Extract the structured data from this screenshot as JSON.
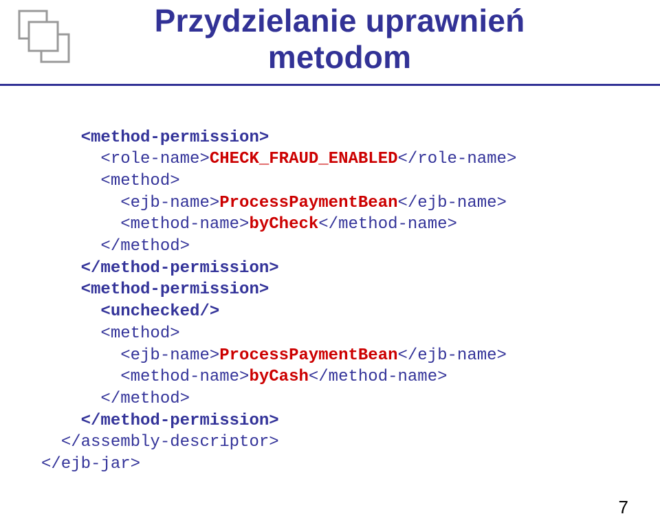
{
  "title_line1": "Przydzielanie uprawnień",
  "title_line2": "metodom",
  "code": {
    "l1p1": "<method-permission>",
    "l2p1": "<role-name>",
    "l2p2": "CHECK_FRAUD_ENABLED",
    "l2p3": "</role-name>",
    "l3p1": "<method>",
    "l4p1": "<ejb-name>",
    "l4p2": "ProcessPaymentBean",
    "l4p3": "</ejb-name>",
    "l5p1": "<method-name>",
    "l5p2": "byCheck",
    "l5p3": "</method-name>",
    "l6p1": "</method>",
    "l7p1": "</method-permission>",
    "l8p1": "<method-permission>",
    "l9p1": "<unchecked/>",
    "l10p1": "<method>",
    "l11p1": "<ejb-name>",
    "l11p2": "ProcessPaymentBean",
    "l11p3": "</ejb-name>",
    "l12p1": "<method-name>",
    "l12p2": "byCash",
    "l12p3": "</method-name>",
    "l13p1": "</method>",
    "l14p1": "</method-permission>",
    "l15p1": "</assembly-descriptor>",
    "l16p1": "</ejb-jar>"
  },
  "page_number": "7"
}
